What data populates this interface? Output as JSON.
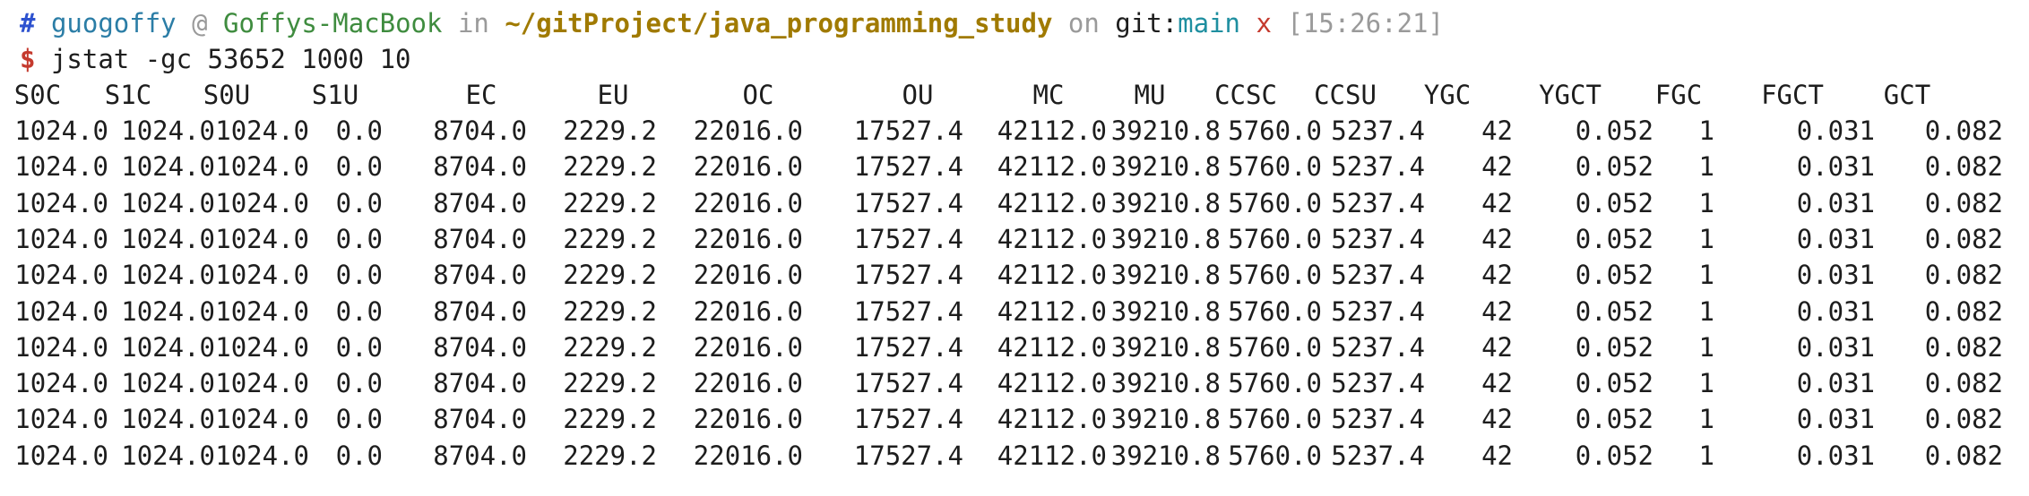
{
  "prompt": {
    "hash": "#",
    "user": "guogoffy",
    "at": "@",
    "host": "Goffys-MacBook",
    "in": "in",
    "path": "~/gitProject/java_programming_study",
    "on": "on",
    "git_label": "git:",
    "branch": "main",
    "dirty": "x",
    "time": "[15:26:21]"
  },
  "command": {
    "dollar": "$",
    "text": "jstat -gc 53652 1000 10"
  },
  "table": {
    "headers": [
      "S0C",
      "S1C",
      "S0U",
      "S1U",
      "EC",
      "EU",
      "OC",
      "OU",
      "MC",
      "MU",
      "CCSC",
      "CCSU",
      "YGC",
      "YGCT",
      "FGC",
      "FGCT",
      "GCT"
    ],
    "rows": [
      [
        "1024.0",
        "1024.0",
        "1024.0",
        "0.0",
        "8704.0",
        "2229.2",
        "22016.0",
        "17527.4",
        "42112.0",
        "39210.8",
        "5760.0",
        "5237.4",
        "42",
        "0.052",
        "1",
        "0.031",
        "0.082"
      ],
      [
        "1024.0",
        "1024.0",
        "1024.0",
        "0.0",
        "8704.0",
        "2229.2",
        "22016.0",
        "17527.4",
        "42112.0",
        "39210.8",
        "5760.0",
        "5237.4",
        "42",
        "0.052",
        "1",
        "0.031",
        "0.082"
      ],
      [
        "1024.0",
        "1024.0",
        "1024.0",
        "0.0",
        "8704.0",
        "2229.2",
        "22016.0",
        "17527.4",
        "42112.0",
        "39210.8",
        "5760.0",
        "5237.4",
        "42",
        "0.052",
        "1",
        "0.031",
        "0.082"
      ],
      [
        "1024.0",
        "1024.0",
        "1024.0",
        "0.0",
        "8704.0",
        "2229.2",
        "22016.0",
        "17527.4",
        "42112.0",
        "39210.8",
        "5760.0",
        "5237.4",
        "42",
        "0.052",
        "1",
        "0.031",
        "0.082"
      ],
      [
        "1024.0",
        "1024.0",
        "1024.0",
        "0.0",
        "8704.0",
        "2229.2",
        "22016.0",
        "17527.4",
        "42112.0",
        "39210.8",
        "5760.0",
        "5237.4",
        "42",
        "0.052",
        "1",
        "0.031",
        "0.082"
      ],
      [
        "1024.0",
        "1024.0",
        "1024.0",
        "0.0",
        "8704.0",
        "2229.2",
        "22016.0",
        "17527.4",
        "42112.0",
        "39210.8",
        "5760.0",
        "5237.4",
        "42",
        "0.052",
        "1",
        "0.031",
        "0.082"
      ],
      [
        "1024.0",
        "1024.0",
        "1024.0",
        "0.0",
        "8704.0",
        "2229.2",
        "22016.0",
        "17527.4",
        "42112.0",
        "39210.8",
        "5760.0",
        "5237.4",
        "42",
        "0.052",
        "1",
        "0.031",
        "0.082"
      ],
      [
        "1024.0",
        "1024.0",
        "1024.0",
        "0.0",
        "8704.0",
        "2229.2",
        "22016.0",
        "17527.4",
        "42112.0",
        "39210.8",
        "5760.0",
        "5237.4",
        "42",
        "0.052",
        "1",
        "0.031",
        "0.082"
      ],
      [
        "1024.0",
        "1024.0",
        "1024.0",
        "0.0",
        "8704.0",
        "2229.2",
        "22016.0",
        "17527.4",
        "42112.0",
        "39210.8",
        "5760.0",
        "5237.4",
        "42",
        "0.052",
        "1",
        "0.031",
        "0.082"
      ],
      [
        "1024.0",
        "1024.0",
        "1024.0",
        "0.0",
        "8704.0",
        "2229.2",
        "22016.0",
        "17527.4",
        "42112.0",
        "39210.8",
        "5760.0",
        "5237.4",
        "42",
        "0.052",
        "1",
        "0.031",
        "0.082"
      ]
    ]
  }
}
